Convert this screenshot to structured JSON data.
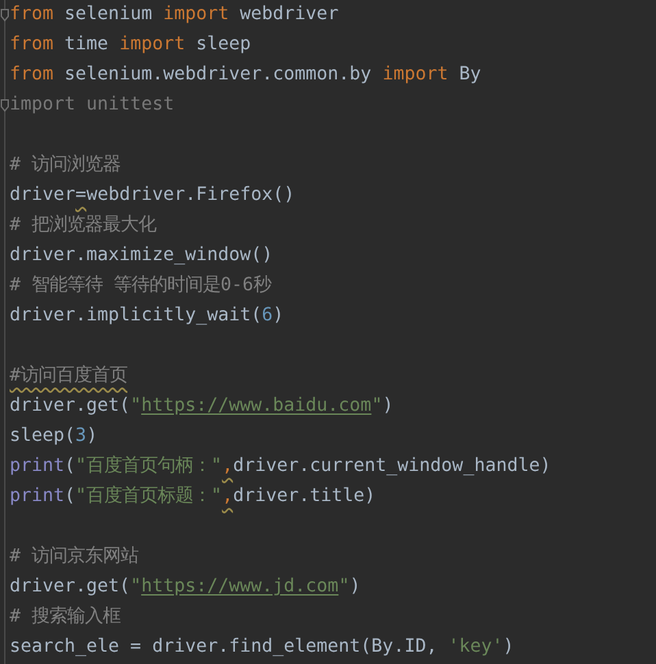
{
  "editor": {
    "lines": [
      {
        "kind": "code",
        "fold_marker": true,
        "tokens": [
          {
            "text": "from",
            "kind": "keyword",
            "warning": false
          },
          {
            "text": " selenium ",
            "kind": "plain",
            "warning": false
          },
          {
            "text": "import",
            "kind": "keyword",
            "warning": false
          },
          {
            "text": " webdriver",
            "kind": "plain",
            "warning": false
          }
        ]
      },
      {
        "kind": "code",
        "fold_marker": false,
        "tokens": [
          {
            "text": "from",
            "kind": "keyword",
            "warning": false
          },
          {
            "text": " time ",
            "kind": "plain",
            "warning": false
          },
          {
            "text": "import",
            "kind": "keyword",
            "warning": false
          },
          {
            "text": " sleep",
            "kind": "plain",
            "warning": false
          }
        ]
      },
      {
        "kind": "code",
        "fold_marker": false,
        "tokens": [
          {
            "text": "from",
            "kind": "keyword",
            "warning": false
          },
          {
            "text": " selenium.webdriver.common.by ",
            "kind": "plain",
            "warning": false
          },
          {
            "text": "import",
            "kind": "keyword",
            "warning": false
          },
          {
            "text": " By",
            "kind": "plain",
            "warning": false
          }
        ]
      },
      {
        "kind": "code",
        "fold_marker": true,
        "tokens": [
          {
            "text": "import unittest",
            "kind": "unused",
            "warning": false
          }
        ]
      },
      {
        "kind": "blank",
        "fold_marker": false
      },
      {
        "kind": "code",
        "fold_marker": false,
        "tokens": [
          {
            "text": "# 访问浏览器",
            "kind": "comment",
            "warning": false
          }
        ]
      },
      {
        "kind": "code",
        "fold_marker": false,
        "tokens": [
          {
            "text": "driver",
            "kind": "plain",
            "warning": false
          },
          {
            "text": "=",
            "kind": "plain",
            "warning": true
          },
          {
            "text": "webdriver.Firefox()",
            "kind": "plain",
            "warning": false
          }
        ]
      },
      {
        "kind": "code",
        "fold_marker": false,
        "tokens": [
          {
            "text": "# 把浏览器最大化",
            "kind": "comment",
            "warning": false
          }
        ]
      },
      {
        "kind": "code",
        "fold_marker": false,
        "tokens": [
          {
            "text": "driver.maximize_window()",
            "kind": "plain",
            "warning": false
          }
        ]
      },
      {
        "kind": "code",
        "fold_marker": false,
        "tokens": [
          {
            "text": "# 智能等待 等待的时间是0-6秒",
            "kind": "comment",
            "warning": false
          }
        ]
      },
      {
        "kind": "code",
        "fold_marker": false,
        "tokens": [
          {
            "text": "driver.implicitly_wait(",
            "kind": "plain",
            "warning": false
          },
          {
            "text": "6",
            "kind": "number",
            "warning": false
          },
          {
            "text": ")",
            "kind": "plain",
            "warning": false
          }
        ]
      },
      {
        "kind": "blank",
        "fold_marker": false
      },
      {
        "kind": "code",
        "fold_marker": false,
        "tokens": [
          {
            "text": "#访问百度首页",
            "kind": "comment",
            "warning": true
          }
        ]
      },
      {
        "kind": "code",
        "fold_marker": false,
        "tokens": [
          {
            "text": "driver.get(",
            "kind": "plain",
            "warning": false
          },
          {
            "text": "\"",
            "kind": "string",
            "warning": false
          },
          {
            "text": "https://www.baidu.com",
            "kind": "url",
            "warning": false
          },
          {
            "text": "\"",
            "kind": "string",
            "warning": false
          },
          {
            "text": ")",
            "kind": "plain",
            "warning": false
          }
        ]
      },
      {
        "kind": "code",
        "fold_marker": false,
        "tokens": [
          {
            "text": "sleep(",
            "kind": "plain",
            "warning": false
          },
          {
            "text": "3",
            "kind": "number",
            "warning": false
          },
          {
            "text": ")",
            "kind": "plain",
            "warning": false
          }
        ]
      },
      {
        "kind": "code",
        "fold_marker": false,
        "tokens": [
          {
            "text": "print",
            "kind": "builtin",
            "warning": false
          },
          {
            "text": "(",
            "kind": "plain",
            "warning": false
          },
          {
            "text": "\"百度首页句柄：\"",
            "kind": "string",
            "warning": false
          },
          {
            "text": ",",
            "kind": "keyword",
            "warning": true
          },
          {
            "text": "driver.current_window_handle)",
            "kind": "plain",
            "warning": false
          }
        ]
      },
      {
        "kind": "code",
        "fold_marker": false,
        "tokens": [
          {
            "text": "print",
            "kind": "builtin",
            "warning": false
          },
          {
            "text": "(",
            "kind": "plain",
            "warning": false
          },
          {
            "text": "\"百度首页标题：\"",
            "kind": "string",
            "warning": false
          },
          {
            "text": ",",
            "kind": "keyword",
            "warning": true
          },
          {
            "text": "driver.title)",
            "kind": "plain",
            "warning": false
          }
        ]
      },
      {
        "kind": "blank",
        "fold_marker": false
      },
      {
        "kind": "code",
        "fold_marker": false,
        "tokens": [
          {
            "text": "# 访问京东网站",
            "kind": "comment",
            "warning": false
          }
        ]
      },
      {
        "kind": "code",
        "fold_marker": false,
        "tokens": [
          {
            "text": "driver.get(",
            "kind": "plain",
            "warning": false
          },
          {
            "text": "\"",
            "kind": "string",
            "warning": false
          },
          {
            "text": "https://www.jd.com",
            "kind": "url",
            "warning": false
          },
          {
            "text": "\"",
            "kind": "string",
            "warning": false
          },
          {
            "text": ")",
            "kind": "plain",
            "warning": false
          }
        ]
      },
      {
        "kind": "code",
        "fold_marker": false,
        "tokens": [
          {
            "text": "# 搜索输入框",
            "kind": "comment",
            "warning": false
          }
        ]
      },
      {
        "kind": "code",
        "fold_marker": false,
        "tokens": [
          {
            "text": "search_ele = driver.find_element(By.ID, ",
            "kind": "plain",
            "warning": false
          },
          {
            "text": "'key'",
            "kind": "string",
            "warning": false
          },
          {
            "text": ")",
            "kind": "plain",
            "warning": false
          }
        ]
      }
    ]
  }
}
